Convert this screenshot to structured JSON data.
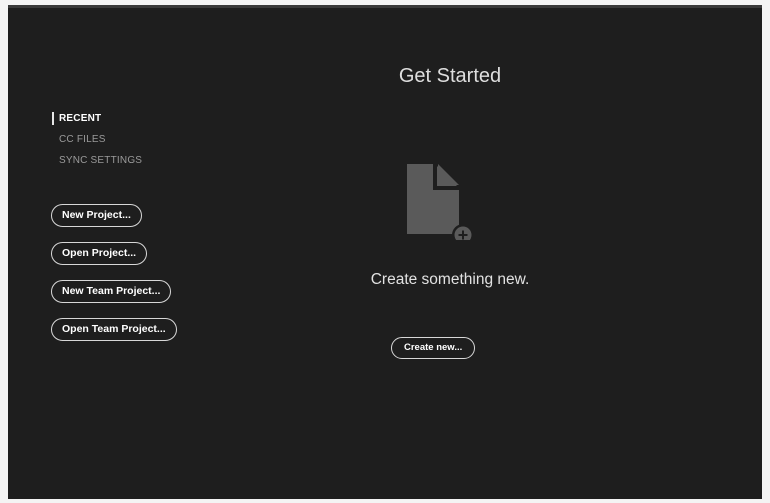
{
  "home": {
    "title": "Get Started",
    "nav": [
      {
        "label": "RECENT",
        "active": true
      },
      {
        "label": "CC FILES",
        "active": false
      },
      {
        "label": "SYNC SETTINGS",
        "active": false
      }
    ],
    "buttons": {
      "new_project": "New Project...",
      "open_project": "Open Project...",
      "new_team_project": "New Team Project...",
      "open_team_project": "Open Team Project..."
    },
    "empty_state": {
      "icon": "document-add-icon",
      "message": "Create something new.",
      "create_label": "Create new..."
    }
  },
  "colors": {
    "background": "#1e1e1e",
    "text": "#d4d4d4",
    "muted": "#9a9a9a",
    "icon": "#5a5a5a"
  }
}
